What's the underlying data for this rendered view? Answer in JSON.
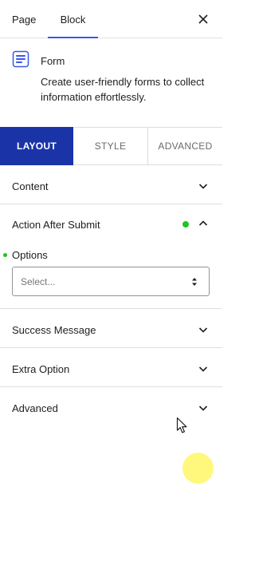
{
  "header": {
    "tabs": [
      {
        "label": "Page",
        "active": false
      },
      {
        "label": "Block",
        "active": true
      }
    ],
    "close_icon": "close-icon",
    "accent_color": "#3858e9"
  },
  "block_card": {
    "icon": "form-icon",
    "name": "Form",
    "description": "Create user-friendly forms to collect information effortlessly."
  },
  "settings_tabs": [
    {
      "label": "LAYOUT",
      "active": true
    },
    {
      "label": "STYLE",
      "active": false
    },
    {
      "label": "ADVANCED",
      "active": false
    }
  ],
  "active_tab_color": "#1a34a8",
  "panels": {
    "content": {
      "title": "Content",
      "expanded": false
    },
    "action_after_submit": {
      "title": "Action After Submit",
      "expanded": true,
      "status_dot_color": "#1bc71b",
      "options_label": "Options",
      "select_value": "Select..."
    },
    "success_message": {
      "title": "Success Message",
      "expanded": false
    },
    "extra_option": {
      "title": "Extra Option",
      "expanded": false
    },
    "advanced": {
      "title": "Advanced",
      "expanded": false
    }
  }
}
